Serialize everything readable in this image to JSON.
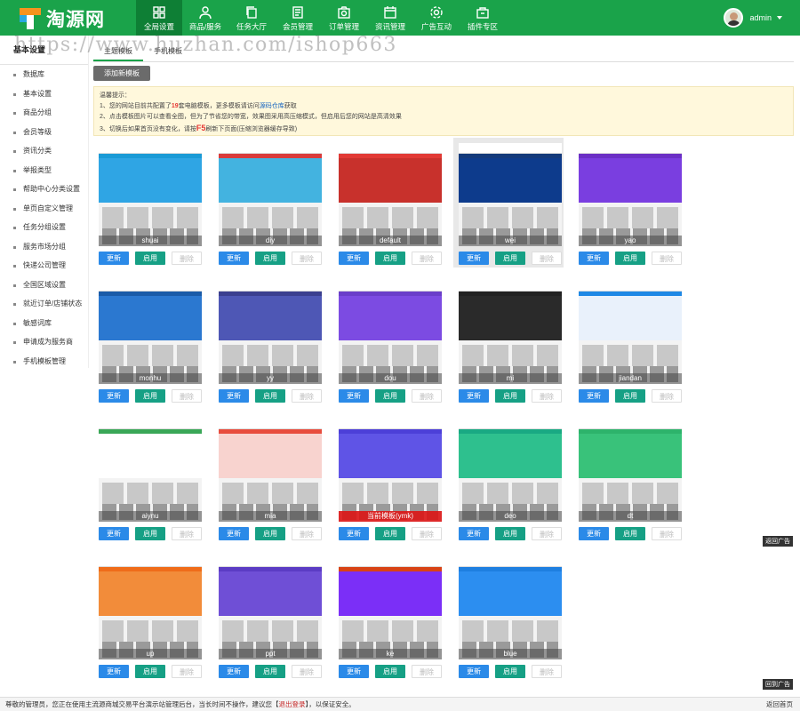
{
  "logo_text": "淘源网",
  "nav": [
    {
      "label": "全局设置",
      "icon": "grid-icon",
      "active": true
    },
    {
      "label": "商品/服务",
      "icon": "user-icon"
    },
    {
      "label": "任务大厅",
      "icon": "copy-icon"
    },
    {
      "label": "会员管理",
      "icon": "doc-icon"
    },
    {
      "label": "订单管理",
      "icon": "camera-icon"
    },
    {
      "label": "资讯管理",
      "icon": "calendar-icon"
    },
    {
      "label": "广告互动",
      "icon": "gear-icon"
    },
    {
      "label": "插件专区",
      "icon": "bag-icon"
    }
  ],
  "user": {
    "name": "admin"
  },
  "watermark": "https://www.huzhan.com/ishop663",
  "sidebar": {
    "title": "基本设置",
    "items": [
      "数据库",
      "基本设置",
      "商品分组",
      "会员等级",
      "资讯分类",
      "举报类型",
      "帮助中心分类设置",
      "单页自定义管理",
      "任务分组设置",
      "服务市场分组",
      "快递公司管理",
      "全国区域设置",
      "就近订单/店铺状态",
      "敏感词库",
      "申请成为服务商",
      "手机模板管理"
    ]
  },
  "tabs": [
    "主题模板",
    "手机模板"
  ],
  "add_button": "添加新模板",
  "tips": {
    "heading": "温馨提示：",
    "line1_a": "1、您的网站目前共配置了",
    "line1_count": "19",
    "line1_b": "套电脑模板，更多模板请访问",
    "line1_link": "源码仓库",
    "line1_c": "获取",
    "line2": "2、点击模板图片可以查看全图，但为了节省您的带宽，效果图采用高压缩模式，但启用后您的网站是高清效果",
    "line3_a": "3、切换后如果首页没有变化，请按",
    "line3_key": "F5",
    "line3_b": "刷新下页面(压缩浏览器缓存导致)"
  },
  "buttons": {
    "update": "更新",
    "enable": "启用",
    "delete": "删除"
  },
  "templates": [
    {
      "name": "shuai",
      "accent": "#1a9ad6",
      "banner": "#2fa5e4"
    },
    {
      "name": "diy",
      "accent": "#d93b3b",
      "banner": "#43b3e0"
    },
    {
      "name": "default",
      "accent": "#e23a35",
      "banner": "#c8312c"
    },
    {
      "name": "wei",
      "accent": "#143a7a",
      "banner": "#0d3b8c",
      "selected": true
    },
    {
      "name": "yao",
      "accent": "#6b2fc5",
      "banner": "#7a3ee0"
    },
    {
      "name": "monhu",
      "accent": "#1a5ba8",
      "banner": "#2b78d0"
    },
    {
      "name": "yy",
      "accent": "#3b3f8f",
      "banner": "#4e57b5"
    },
    {
      "name": "dou",
      "accent": "#6a3ec9",
      "banner": "#7c4be2"
    },
    {
      "name": "mi",
      "accent": "#222222",
      "banner": "#2a2a2a"
    },
    {
      "name": "jiandan",
      "accent": "#1e88e5",
      "banner": "#e9f1fb"
    },
    {
      "name": "aiynu",
      "accent": "#3aa757",
      "banner": "#ffffff"
    },
    {
      "name": "mia",
      "accent": "#e84c3d",
      "banner": "#f8d3cf"
    },
    {
      "name": "当前模板(ymk)",
      "accent": "#4c3fd8",
      "banner": "#5f54e6",
      "current": true
    },
    {
      "name": "deo",
      "accent": "#19a983",
      "banner": "#2ec08e"
    },
    {
      "name": "dt",
      "accent": "#2db36b",
      "banner": "#39c27a"
    },
    {
      "name": "up",
      "accent": "#ef6c1a",
      "banner": "#f28c3a"
    },
    {
      "name": "ppt",
      "accent": "#5b3cc4",
      "banner": "#6f4fd6"
    },
    {
      "name": "ke",
      "accent": "#d84315",
      "banner": "#7b2ff7"
    },
    {
      "name": "blue",
      "accent": "#1e7fe0",
      "banner": "#2c8ef0"
    }
  ],
  "floats": {
    "top": "返回广告",
    "bottom": "回到广告"
  },
  "footer": {
    "text_a": "尊敬的管理员，您正在使用主流源商城交易平台演示站管理后台，当长时间不操作，建议您【",
    "logout": "退出登录",
    "text_b": "】，以保证安全。",
    "right": "返回首页"
  }
}
